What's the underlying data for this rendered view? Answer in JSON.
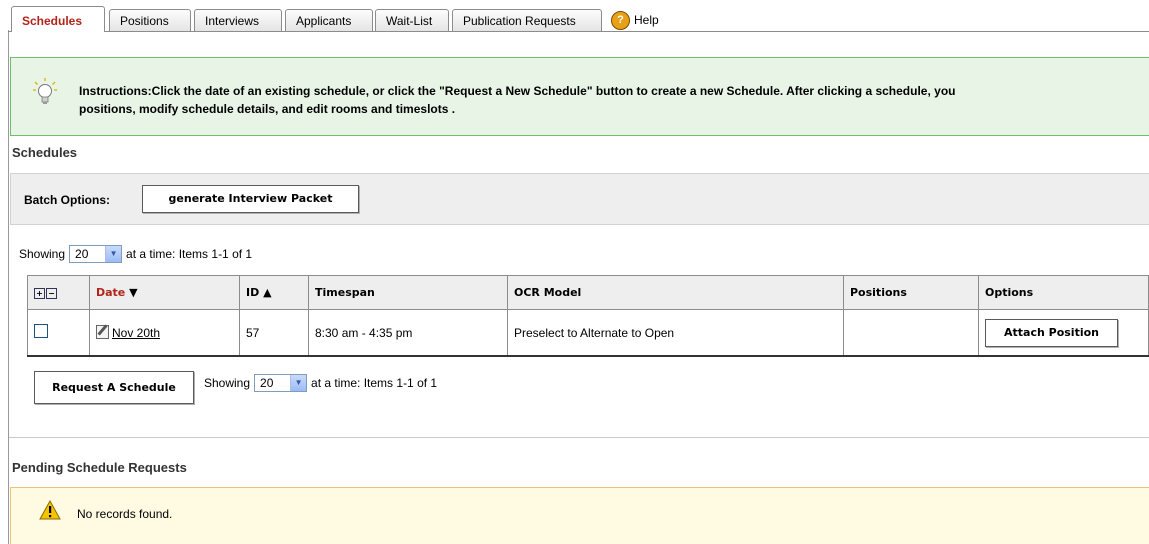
{
  "tabs": [
    {
      "label": "Schedules",
      "active": true
    },
    {
      "label": "Positions"
    },
    {
      "label": "Interviews"
    },
    {
      "label": "Applicants"
    },
    {
      "label": "Wait-List"
    },
    {
      "label": "Publication Requests"
    }
  ],
  "help_label": "Help",
  "instructions": {
    "line1": "Instructions:Click the date of an existing schedule, or click the \"Request a New Schedule\" button to create a new Schedule. After clicking a schedule, you",
    "line2": "positions, modify schedule details, and edit rooms and timeslots ."
  },
  "schedules_title": "Schedules",
  "batch": {
    "label": "Batch Options:",
    "button": "generate Interview Packet"
  },
  "paging": {
    "prefix": "Showing",
    "page_size": "20",
    "suffix": "at a time: Items 1-1 of 1"
  },
  "table": {
    "columns": [
      "Date",
      "ID",
      "Timespan",
      "OCR Model",
      "Positions",
      "Options"
    ],
    "sort_date": "▼",
    "sort_id": "▲",
    "rows": [
      {
        "date": "Nov 20th",
        "id": "57",
        "timespan": "8:30 am - 4:35 pm",
        "ocr_model": "Preselect to Alternate to Open",
        "positions": "",
        "option": "Attach Position"
      }
    ]
  },
  "request_button": "Request A Schedule",
  "pending": {
    "title": "Pending Schedule Requests",
    "message": "No records found."
  },
  "colors": {
    "active_tab": "#b2241a",
    "instructions_bg": "#e7f4e6",
    "warning_bg": "#fffbe2"
  }
}
